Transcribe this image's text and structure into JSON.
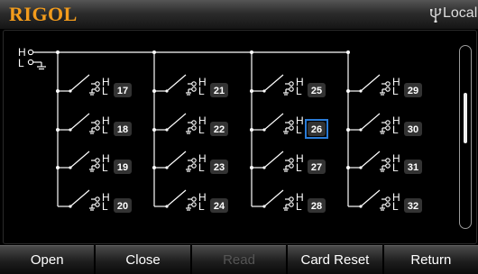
{
  "header": {
    "brand": "RIGOL",
    "status_icon": "usb-icon",
    "status_text": "Local"
  },
  "terminals": {
    "high": "H",
    "low": "L"
  },
  "channels": [
    {
      "number": "17",
      "selected": false
    },
    {
      "number": "18",
      "selected": false
    },
    {
      "number": "19",
      "selected": false
    },
    {
      "number": "20",
      "selected": false
    },
    {
      "number": "21",
      "selected": false
    },
    {
      "number": "22",
      "selected": false
    },
    {
      "number": "23",
      "selected": false
    },
    {
      "number": "24",
      "selected": false
    },
    {
      "number": "25",
      "selected": false
    },
    {
      "number": "26",
      "selected": true
    },
    {
      "number": "27",
      "selected": false
    },
    {
      "number": "28",
      "selected": false
    },
    {
      "number": "29",
      "selected": false
    },
    {
      "number": "30",
      "selected": false
    },
    {
      "number": "31",
      "selected": false
    },
    {
      "number": "32",
      "selected": false
    }
  ],
  "softkeys": [
    {
      "label": "Open",
      "enabled": true
    },
    {
      "label": "Close",
      "enabled": true
    },
    {
      "label": "Read",
      "enabled": false
    },
    {
      "label": "Card Reset",
      "enabled": true
    },
    {
      "label": "Return",
      "enabled": true
    }
  ],
  "colors": {
    "brand": "#f39c1c",
    "selection_border": "#2a7bd6",
    "channel_badge": "#333333"
  }
}
